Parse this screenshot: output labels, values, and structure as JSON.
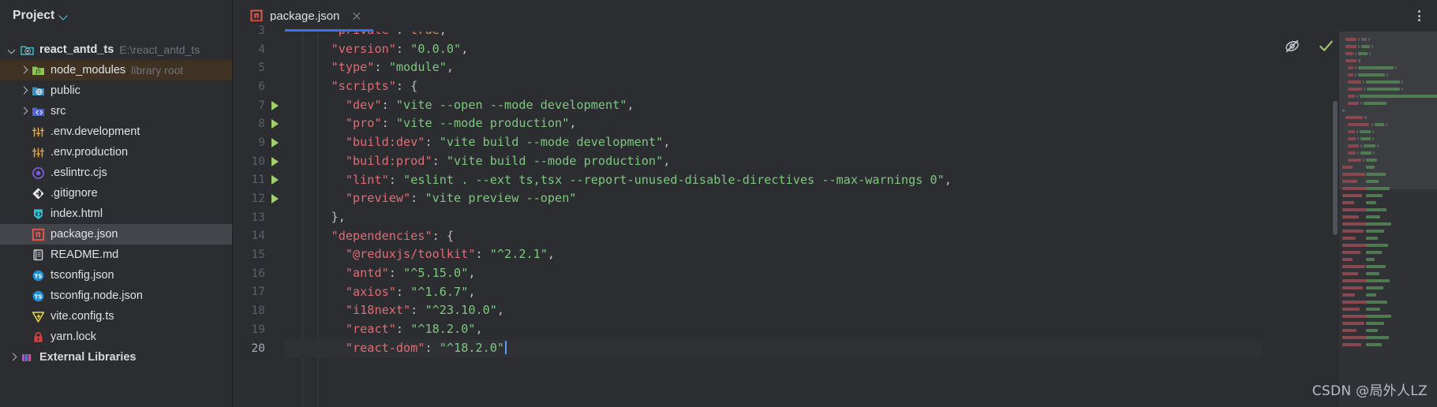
{
  "sidebar": {
    "title": "Project",
    "title_chevron_icon": "chevron-down-icon",
    "items": [
      {
        "label": "react_antd_ts",
        "sub": "E:\\react_antd_ts",
        "icon": "module-folder-icon",
        "arrow": "down",
        "depth": 0,
        "state": "normal"
      },
      {
        "label": "node_modules",
        "sub": "library root",
        "icon": "node-folder-icon",
        "arrow": "right",
        "depth": 1,
        "state": "hovered"
      },
      {
        "label": "public",
        "sub": "",
        "icon": "web-folder-icon",
        "arrow": "right",
        "depth": 1,
        "state": "normal"
      },
      {
        "label": "src",
        "sub": "",
        "icon": "source-folder-icon",
        "arrow": "right",
        "depth": 1,
        "state": "normal"
      },
      {
        "label": ".env.development",
        "sub": "",
        "icon": "env-file-icon",
        "arrow": "none",
        "depth": 1,
        "state": "normal"
      },
      {
        "label": ".env.production",
        "sub": "",
        "icon": "env-file-icon",
        "arrow": "none",
        "depth": 1,
        "state": "normal"
      },
      {
        "label": ".eslintrc.cjs",
        "sub": "",
        "icon": "eslint-file-icon",
        "arrow": "none",
        "depth": 1,
        "state": "normal"
      },
      {
        "label": ".gitignore",
        "sub": "",
        "icon": "git-file-icon",
        "arrow": "none",
        "depth": 1,
        "state": "normal"
      },
      {
        "label": "index.html",
        "sub": "",
        "icon": "html-file-icon",
        "arrow": "none",
        "depth": 1,
        "state": "normal"
      },
      {
        "label": "package.json",
        "sub": "",
        "icon": "npm-file-icon",
        "arrow": "none",
        "depth": 1,
        "state": "selected"
      },
      {
        "label": "README.md",
        "sub": "",
        "icon": "markdown-file-icon",
        "arrow": "none",
        "depth": 1,
        "state": "normal"
      },
      {
        "label": "tsconfig.json",
        "sub": "",
        "icon": "typescript-file-icon",
        "arrow": "none",
        "depth": 1,
        "state": "normal"
      },
      {
        "label": "tsconfig.node.json",
        "sub": "",
        "icon": "typescript-file-icon",
        "arrow": "none",
        "depth": 1,
        "state": "normal"
      },
      {
        "label": "vite.config.ts",
        "sub": "",
        "icon": "vite-file-icon",
        "arrow": "none",
        "depth": 1,
        "state": "normal"
      },
      {
        "label": "yarn.lock",
        "sub": "",
        "icon": "lock-file-icon",
        "arrow": "none",
        "depth": 1,
        "state": "normal"
      },
      {
        "label": "External Libraries",
        "sub": "",
        "icon": "library-icon",
        "arrow": "right",
        "depth": 0,
        "state": "partial"
      }
    ]
  },
  "editor": {
    "tab": {
      "label": "package.json",
      "icon": "npm-file-icon",
      "close_icon": "close-icon",
      "active": true
    },
    "more_actions_icon": "kebab-menu-icon",
    "inspections": {
      "reader_mode_icon": "eye-off-icon",
      "status_icon": "check-icon",
      "status_color": "#97c36b"
    },
    "first_visible_line": 3,
    "lines": [
      {
        "num": 3,
        "run": false,
        "highlight": false,
        "clipped": true,
        "tokens": [
          {
            "t": "p",
            "v": "    "
          },
          {
            "t": "k",
            "v": "\"private\""
          },
          {
            "t": "p",
            "v": ": "
          },
          {
            "t": "kw",
            "v": "true"
          },
          {
            "t": "p",
            "v": ","
          }
        ]
      },
      {
        "num": 4,
        "run": false,
        "highlight": false,
        "tokens": [
          {
            "t": "p",
            "v": "    "
          },
          {
            "t": "k",
            "v": "\"version\""
          },
          {
            "t": "p",
            "v": ": "
          },
          {
            "t": "s",
            "v": "\"0.0.0\""
          },
          {
            "t": "p",
            "v": ","
          }
        ]
      },
      {
        "num": 5,
        "run": false,
        "highlight": false,
        "tokens": [
          {
            "t": "p",
            "v": "    "
          },
          {
            "t": "k",
            "v": "\"type\""
          },
          {
            "t": "p",
            "v": ": "
          },
          {
            "t": "s",
            "v": "\"module\""
          },
          {
            "t": "p",
            "v": ","
          }
        ]
      },
      {
        "num": 6,
        "run": false,
        "highlight": false,
        "tokens": [
          {
            "t": "p",
            "v": "    "
          },
          {
            "t": "k",
            "v": "\"scripts\""
          },
          {
            "t": "p",
            "v": ": {"
          }
        ]
      },
      {
        "num": 7,
        "run": true,
        "highlight": false,
        "tokens": [
          {
            "t": "p",
            "v": "      "
          },
          {
            "t": "k",
            "v": "\"dev\""
          },
          {
            "t": "p",
            "v": ": "
          },
          {
            "t": "s",
            "v": "\"vite --open --mode development\""
          },
          {
            "t": "p",
            "v": ","
          }
        ]
      },
      {
        "num": 8,
        "run": true,
        "highlight": false,
        "tokens": [
          {
            "t": "p",
            "v": "      "
          },
          {
            "t": "k",
            "v": "\"pro\""
          },
          {
            "t": "p",
            "v": ": "
          },
          {
            "t": "s",
            "v": "\"vite --mode production\""
          },
          {
            "t": "p",
            "v": ","
          }
        ]
      },
      {
        "num": 9,
        "run": true,
        "highlight": false,
        "tokens": [
          {
            "t": "p",
            "v": "      "
          },
          {
            "t": "k",
            "v": "\"build:dev\""
          },
          {
            "t": "p",
            "v": ": "
          },
          {
            "t": "s",
            "v": "\"vite build --mode development\""
          },
          {
            "t": "p",
            "v": ","
          }
        ]
      },
      {
        "num": 10,
        "run": true,
        "highlight": false,
        "tokens": [
          {
            "t": "p",
            "v": "      "
          },
          {
            "t": "k",
            "v": "\"build:prod\""
          },
          {
            "t": "p",
            "v": ": "
          },
          {
            "t": "s",
            "v": "\"vite build --mode production\""
          },
          {
            "t": "p",
            "v": ","
          }
        ]
      },
      {
        "num": 11,
        "run": true,
        "highlight": false,
        "tokens": [
          {
            "t": "p",
            "v": "      "
          },
          {
            "t": "k",
            "v": "\"lint\""
          },
          {
            "t": "p",
            "v": ": "
          },
          {
            "t": "s",
            "v": "\"eslint . --ext ts,tsx --report-unused-disable-directives --max-warnings 0\""
          },
          {
            "t": "p",
            "v": ","
          }
        ]
      },
      {
        "num": 12,
        "run": true,
        "highlight": false,
        "tokens": [
          {
            "t": "p",
            "v": "      "
          },
          {
            "t": "k",
            "v": "\"preview\""
          },
          {
            "t": "p",
            "v": ": "
          },
          {
            "t": "s",
            "v": "\"vite preview --open\""
          }
        ]
      },
      {
        "num": 13,
        "run": false,
        "highlight": false,
        "tokens": [
          {
            "t": "p",
            "v": "    },"
          }
        ]
      },
      {
        "num": 14,
        "run": false,
        "highlight": false,
        "tokens": [
          {
            "t": "p",
            "v": "    "
          },
          {
            "t": "k",
            "v": "\"dependencies\""
          },
          {
            "t": "p",
            "v": ": {"
          }
        ]
      },
      {
        "num": 15,
        "run": false,
        "highlight": false,
        "tokens": [
          {
            "t": "p",
            "v": "      "
          },
          {
            "t": "k",
            "v": "\"@reduxjs/toolkit\""
          },
          {
            "t": "p",
            "v": ": "
          },
          {
            "t": "s",
            "v": "\"^2.2.1\""
          },
          {
            "t": "p",
            "v": ","
          }
        ]
      },
      {
        "num": 16,
        "run": false,
        "highlight": false,
        "tokens": [
          {
            "t": "p",
            "v": "      "
          },
          {
            "t": "k",
            "v": "\"antd\""
          },
          {
            "t": "p",
            "v": ": "
          },
          {
            "t": "s",
            "v": "\"^5.15.0\""
          },
          {
            "t": "p",
            "v": ","
          }
        ]
      },
      {
        "num": 17,
        "run": false,
        "highlight": false,
        "tokens": [
          {
            "t": "p",
            "v": "      "
          },
          {
            "t": "k",
            "v": "\"axios\""
          },
          {
            "t": "p",
            "v": ": "
          },
          {
            "t": "s",
            "v": "\"^1.6.7\""
          },
          {
            "t": "p",
            "v": ","
          }
        ]
      },
      {
        "num": 18,
        "run": false,
        "highlight": false,
        "tokens": [
          {
            "t": "p",
            "v": "      "
          },
          {
            "t": "k",
            "v": "\"i18next\""
          },
          {
            "t": "p",
            "v": ": "
          },
          {
            "t": "s",
            "v": "\"^23.10.0\""
          },
          {
            "t": "p",
            "v": ","
          }
        ]
      },
      {
        "num": 19,
        "run": false,
        "highlight": false,
        "tokens": [
          {
            "t": "p",
            "v": "      "
          },
          {
            "t": "k",
            "v": "\"react\""
          },
          {
            "t": "p",
            "v": ": "
          },
          {
            "t": "s",
            "v": "\"^18.2.0\""
          },
          {
            "t": "p",
            "v": ","
          }
        ]
      },
      {
        "num": 20,
        "run": false,
        "highlight": true,
        "cursor": true,
        "clipped": true,
        "tokens": [
          {
            "t": "p",
            "v": "      "
          },
          {
            "t": "k",
            "v": "\"react-dom\""
          },
          {
            "t": "p",
            "v": ": "
          },
          {
            "t": "s",
            "v": "\"^18.2.0\""
          }
        ]
      }
    ]
  },
  "watermark": "CSDN @局外人LZ",
  "colors": {
    "background": "#2b2d30",
    "sidebar_selected": "#43454a",
    "sidebar_hover": "#3f3222",
    "tab_underline": "#3574f0",
    "key": "#e06c75",
    "string": "#7ec77f",
    "keyword": "#cf8e6d",
    "punctuation": "#bcbec4",
    "line_number": "#5c6066",
    "run_arrow": "#9fd06a"
  }
}
